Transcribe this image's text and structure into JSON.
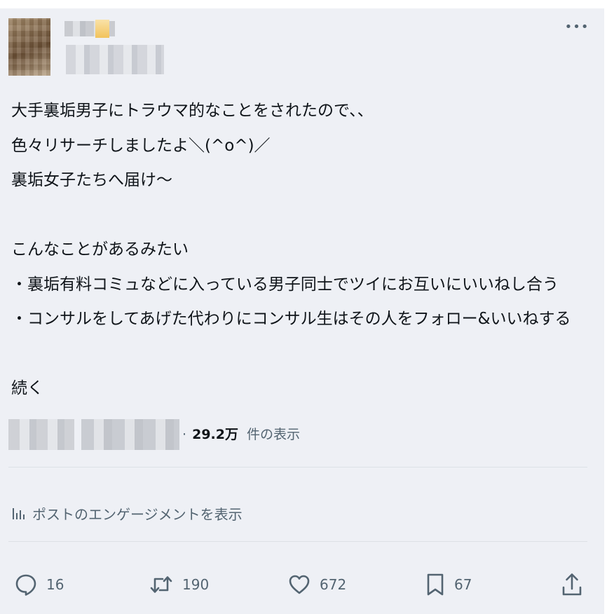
{
  "tweet": {
    "author": {
      "avatar_icon": "blurred-avatar-image",
      "name_blurred": true,
      "handle_blurred": true
    },
    "more_icon": "more-horizontal-icon",
    "more_glyph": "•••",
    "body_lines": [
      "大手裏垢男子にトラウマ的なことをされたので、、",
      "色々リサーチしましたよ＼(^o^)／",
      "裏垢女子たちへ届け〜",
      "",
      "こんなことがあるみたい",
      "・裏垢有料コミュなどに入っている男子同士でツイにお互いにいいねし合う",
      "・コンサルをしてあげた代わりにコンサル生はその人をフォロー&いいねする",
      "",
      "続く"
    ],
    "meta": {
      "separator": "·",
      "views_count": "29.2万",
      "views_label": "件の表示"
    },
    "engagement_link": "ポストのエンゲージメントを表示",
    "actions": {
      "reply": {
        "icon": "reply-icon",
        "count": "16"
      },
      "repost": {
        "icon": "repost-icon",
        "count": "190"
      },
      "like": {
        "icon": "heart-icon",
        "count": "672"
      },
      "bookmark": {
        "icon": "bookmark-icon",
        "count": "67"
      },
      "share": {
        "icon": "share-icon"
      }
    },
    "colors": {
      "background": "#eef0f5",
      "text": "#0f1419",
      "secondary": "#536471",
      "divider": "#dde1e6"
    }
  }
}
